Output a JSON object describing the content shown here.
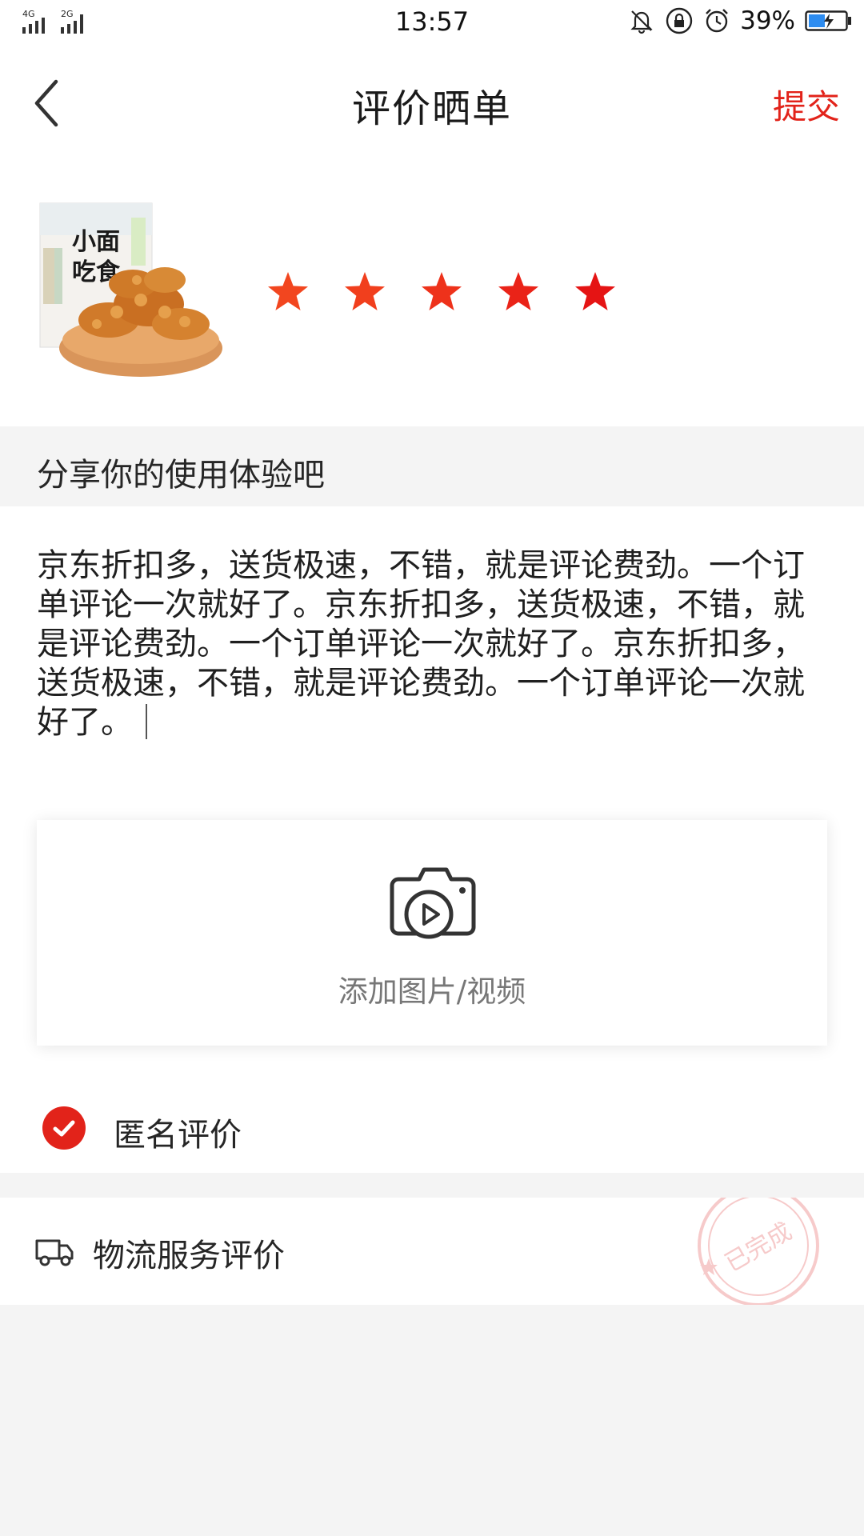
{
  "status_bar": {
    "time": "13:57",
    "network_1": "4G",
    "network_2": "2G",
    "battery": "39%",
    "icons": [
      "signal-icon",
      "mute-bell-icon",
      "rotation-lock-icon",
      "alarm-icon",
      "battery-icon"
    ]
  },
  "header": {
    "title": "评价晒单",
    "submit_label": "提交",
    "back_icon": "chevron-left-icon"
  },
  "product": {
    "image_alt": "小面吃食 麻花",
    "image_text_1": "小面",
    "image_text_2": "吃食",
    "rating": 5,
    "max_rating": 5,
    "star_colors": [
      "#f2461f",
      "#f13f1d",
      "#ee321b",
      "#ea2318",
      "#e51414"
    ]
  },
  "share": {
    "label": "分享你的使用体验吧"
  },
  "review": {
    "text": "京东折扣多，送货极速，不错，就是评论费劲。一个订单评论一次就好了。京东折扣多，送货极速，不错，就是评论费劲。一个订单评论一次就好了。京东折扣多，送货极速，不错，就是评论费劲。一个订单评论一次就好了。"
  },
  "media": {
    "label": "添加图片/视频",
    "icon": "camera-video-icon"
  },
  "anonymous": {
    "label": "匿名评价",
    "checked": true
  },
  "logistics": {
    "label": "物流服务评价",
    "icon": "truck-icon",
    "stamp_text": "已完成"
  },
  "colors": {
    "accent": "#e2231a",
    "background": "#f4f4f4"
  }
}
